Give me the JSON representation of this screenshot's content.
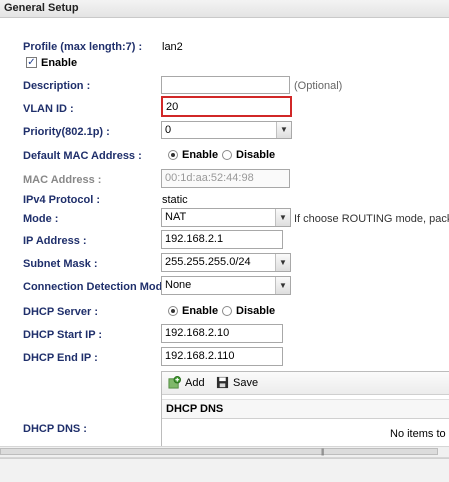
{
  "panel": {
    "title": "General Setup"
  },
  "profile": {
    "label": "Profile (max length:7) :",
    "value": "lan2"
  },
  "enable_checkbox": {
    "label": "Enable",
    "checked": true,
    "mark": "✓"
  },
  "description": {
    "label": "Description :",
    "value": "",
    "hint": "(Optional)"
  },
  "vlan_id": {
    "label": "VLAN ID :",
    "value": "20"
  },
  "priority": {
    "label": "Priority(802.1p) :",
    "value": "0"
  },
  "default_mac": {
    "label": "Default MAC Address :",
    "option_enable": "Enable",
    "option_disable": "Disable",
    "selected": "Enable"
  },
  "mac_address": {
    "label": "MAC Address :",
    "value": "00:1d:aa:52:44:98"
  },
  "ipv4_protocol": {
    "label": "IPv4 Protocol :",
    "value": "static"
  },
  "mode": {
    "label": "Mode :",
    "value": "NAT",
    "hint": "If choose ROUTING mode, packets"
  },
  "ip_address": {
    "label": "IP Address :",
    "value": "192.168.2.1"
  },
  "subnet_mask": {
    "label": "Subnet Mask :",
    "value": "255.255.255.0/24"
  },
  "connection_detection": {
    "label": "Connection Detection Mode :",
    "value": "None"
  },
  "dhcp_server": {
    "label": "DHCP Server :",
    "option_enable": "Enable",
    "option_disable": "Disable",
    "selected": "Enable"
  },
  "dhcp_start": {
    "label": "DHCP Start IP :",
    "value": "192.168.2.10"
  },
  "dhcp_end": {
    "label": "DHCP End IP :",
    "value": "192.168.2.110"
  },
  "dhcp_dns": {
    "label": "DHCP DNS :",
    "add_label": "Add",
    "save_label": "Save",
    "column_header": "DHCP DNS",
    "empty_text": "No items to sh"
  },
  "icons": {
    "dropdown": "chevron-down-icon",
    "add": "add-icon",
    "save": "save-icon",
    "scroll_grip": "grip-icon"
  },
  "scroll_grip": "|||",
  "colors": {
    "label": "#1f2f6b",
    "focus_border": "#d12727",
    "header_bg": "#e8e8e8"
  }
}
